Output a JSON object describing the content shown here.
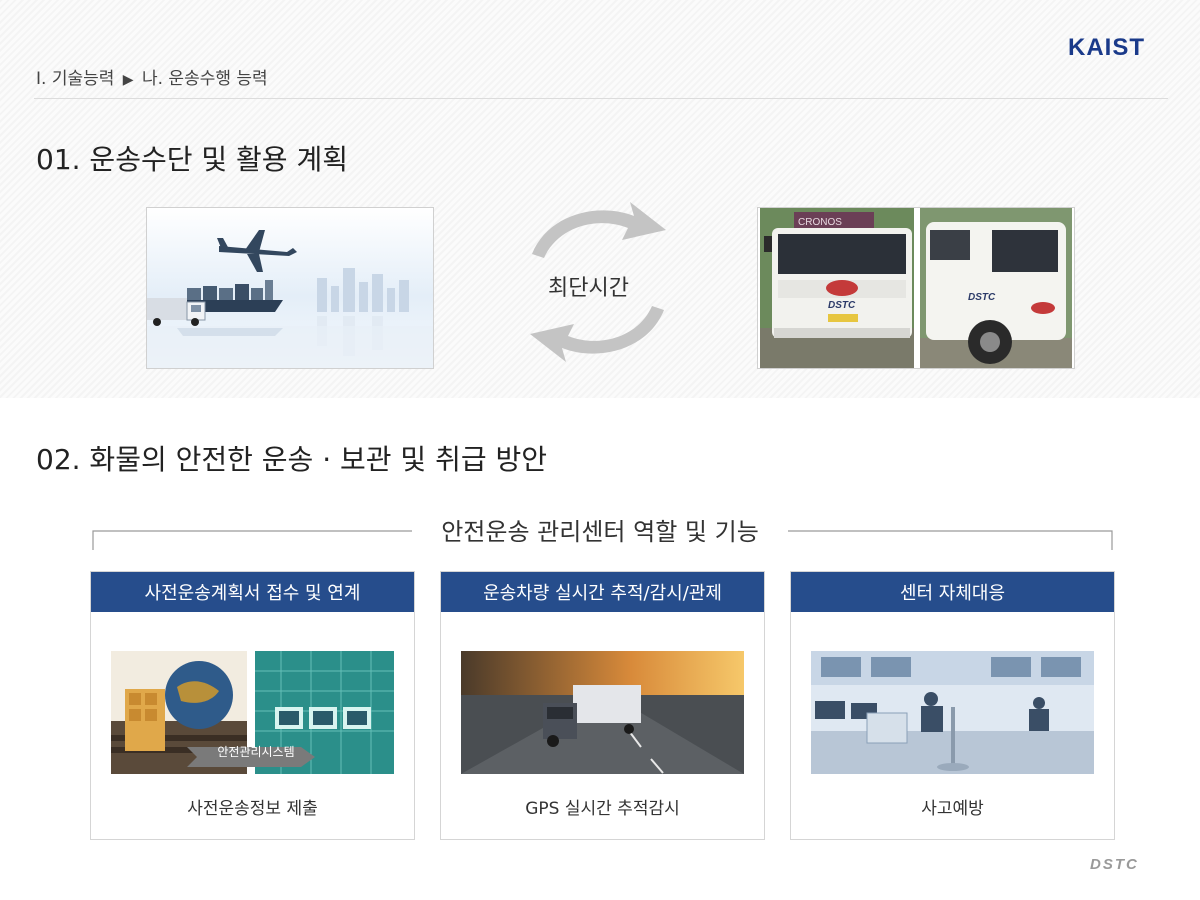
{
  "header": {
    "breadcrumb_part1": "Ⅰ. 기술능력",
    "breadcrumb_separator": "▶",
    "breadcrumb_part2": "나. 운송수행 능력",
    "logo_text": "KAIST"
  },
  "section1": {
    "title": "01. 운송수단 및 활용 계획",
    "cycle_label": "최단시간",
    "truck_signs": {
      "left_top_sign": "CRONOS",
      "left_plate": "DSTC",
      "right_door": "DSTC"
    }
  },
  "section2": {
    "title": "02. 화물의 안전한 운송 · 보관 및 취급 방안",
    "bracket_title": "안전운송 관리센터 역할 및 기능",
    "cards": [
      {
        "header": "사전운송계획서 접수 및 연계",
        "caption": "사전운송정보 제출",
        "overlay_label": "안전관리시스템"
      },
      {
        "header": "운송차량 실시간 추적/감시/관제",
        "caption": "GPS 실시간 추적감시"
      },
      {
        "header": "센터 자체대응",
        "caption": "사고예방"
      }
    ]
  },
  "footer": {
    "logo_text": "DSTC"
  },
  "colors": {
    "accent": "#264d8c",
    "logo": "#1a3a8a",
    "arrow_gray": "#c4c4c4"
  }
}
